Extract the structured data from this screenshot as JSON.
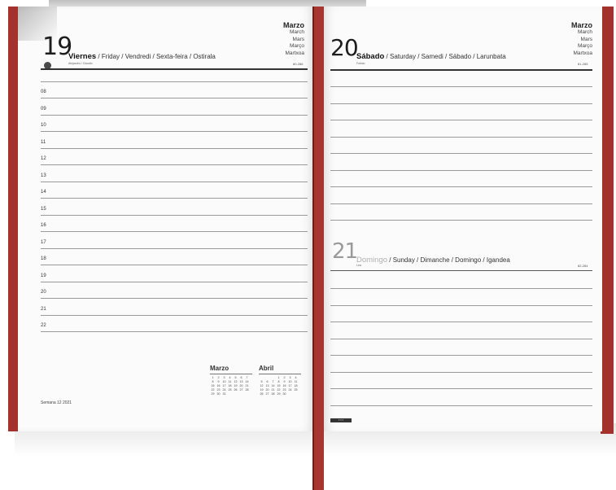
{
  "left_page": {
    "day_number": "19",
    "day_name": "Viernes",
    "day_translations": " / Friday / Vendredi / Sexta-feira / Ostirala",
    "saint": "Alejandro / Claudio",
    "day_index": "80-286",
    "month_names": [
      "Marzo",
      "March",
      "Mars",
      "Março",
      "Martxoa"
    ],
    "hours": [
      "08",
      "09",
      "10",
      "11",
      "12",
      "13",
      "14",
      "15",
      "16",
      "17",
      "18",
      "19",
      "20",
      "21",
      "22"
    ],
    "week_footer": "Semana 12  2021"
  },
  "right_page": {
    "day_number": "20",
    "day_name": "Sábado",
    "day_translations": " / Saturday / Samedi / Sábado / Larunbata",
    "saint": "Fotinio",
    "day_index": "81-285",
    "month_names": [
      "Marzo",
      "March",
      "Mars",
      "Março",
      "Martxoa"
    ],
    "sunday": {
      "day_number": "21",
      "day_name": "Domingo",
      "day_translations": " / Sunday / Dimanche / Domingo / Igandea",
      "saint": "Lea",
      "day_index": "82-284"
    },
    "logo_text": "▪ ▪ ▪"
  },
  "mini_calendars": [
    {
      "title": "Marzo",
      "days": [
        "1",
        "2",
        "3",
        "4",
        "5",
        "6",
        "7",
        "8",
        "9",
        "10",
        "11",
        "12",
        "13",
        "14",
        "15",
        "16",
        "17",
        "18",
        "19",
        "20",
        "21",
        "22",
        "23",
        "24",
        "25",
        "26",
        "27",
        "28",
        "29",
        "30",
        "31"
      ]
    },
    {
      "title": "Abril",
      "days": [
        "",
        "",
        "",
        "1",
        "2",
        "3",
        "4",
        "5",
        "6",
        "7",
        "8",
        "9",
        "10",
        "11",
        "12",
        "13",
        "14",
        "15",
        "16",
        "17",
        "18",
        "19",
        "20",
        "21",
        "22",
        "23",
        "24",
        "25",
        "26",
        "27",
        "28",
        "29",
        "30"
      ]
    }
  ],
  "colors": {
    "cover": "#a3312c",
    "page": "#fbfbfb",
    "rule": "#9a9a9a"
  }
}
